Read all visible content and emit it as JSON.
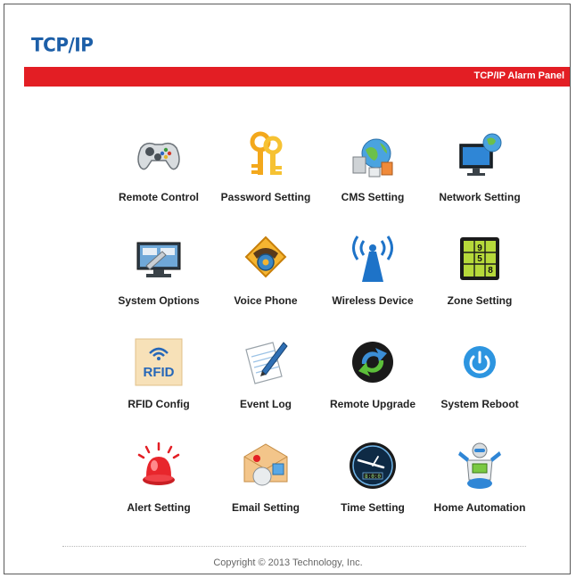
{
  "header": {
    "logo_text": "TCP/IP",
    "banner_title": "TCP/IP Alarm Panel"
  },
  "colors": {
    "banner": "#e31e24",
    "logo": "#1d5fa8"
  },
  "menu": {
    "items": [
      {
        "label": "Remote Control",
        "icon": "gamepad-icon"
      },
      {
        "label": "Password Setting",
        "icon": "keys-icon"
      },
      {
        "label": "CMS Setting",
        "icon": "cms-globe-icon"
      },
      {
        "label": "Network Setting",
        "icon": "monitor-globe-icon"
      },
      {
        "label": "System Options",
        "icon": "system-tools-icon"
      },
      {
        "label": "Voice Phone",
        "icon": "phone-icon"
      },
      {
        "label": "Wireless Device",
        "icon": "antenna-icon"
      },
      {
        "label": "Zone Setting",
        "icon": "zone-grid-icon"
      },
      {
        "label": "RFID Config",
        "icon": "rfid-icon"
      },
      {
        "label": "Event Log",
        "icon": "notepad-pen-icon"
      },
      {
        "label": "Remote Upgrade",
        "icon": "refresh-icon"
      },
      {
        "label": "System Reboot",
        "icon": "power-icon"
      },
      {
        "label": "Alert Setting",
        "icon": "alarm-light-icon"
      },
      {
        "label": "Email Setting",
        "icon": "email-stamp-icon"
      },
      {
        "label": "Time Setting",
        "icon": "clock-icon"
      },
      {
        "label": "Home Automation",
        "icon": "robot-icon"
      }
    ]
  },
  "icon_text": {
    "rfid": "RFID",
    "zone_digits": [
      "9",
      "5",
      "8"
    ],
    "clock_display": "8:0:0"
  },
  "footer": {
    "copyright": "Copyright © 2013 Technology, Inc."
  }
}
